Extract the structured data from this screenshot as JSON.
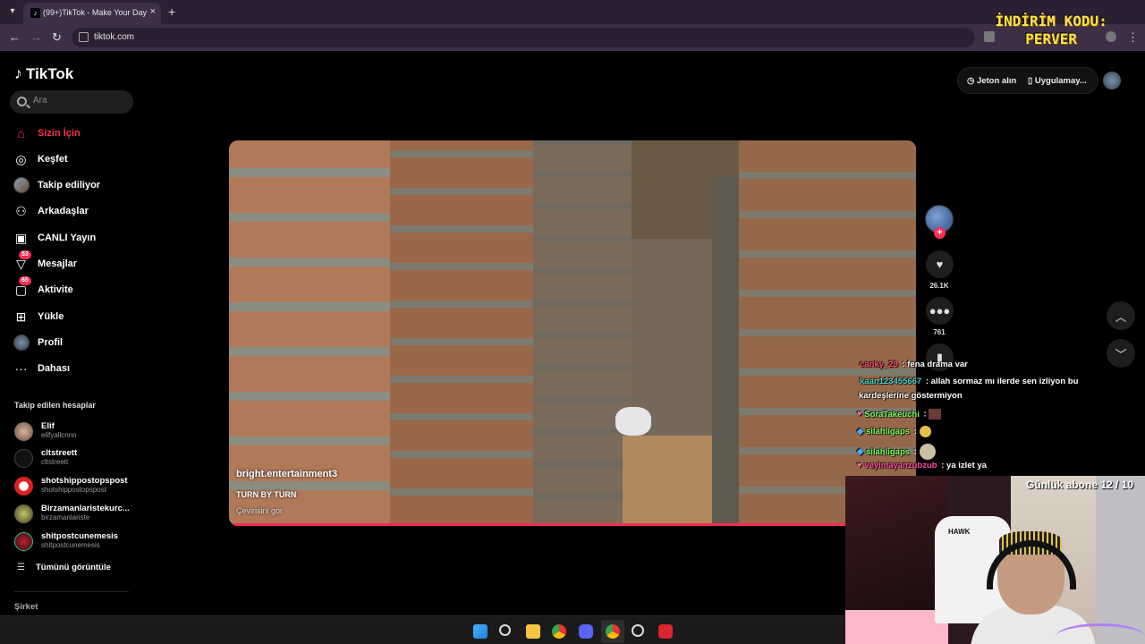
{
  "browser": {
    "tab_title": "(99+)TikTok - Make Your Day",
    "tab_close": "×",
    "new_tab": "+",
    "url": "tiktok.com",
    "promo_line1": "İNDİRİM KODU:",
    "promo_line2": "PERVER"
  },
  "sidebar": {
    "logo": "TikTok",
    "search_placeholder": "Ara",
    "items": [
      {
        "label": "Sizin İçin",
        "icon": "home-icon",
        "active": true
      },
      {
        "label": "Keşfet",
        "icon": "compass-icon"
      },
      {
        "label": "Takip ediliyor",
        "icon": "following-avatar"
      },
      {
        "label": "Arkadaşlar",
        "icon": "friends-icon"
      },
      {
        "label": "CANLI Yayın",
        "icon": "live-icon"
      },
      {
        "label": "Mesajlar",
        "icon": "messages-icon",
        "badge": "53"
      },
      {
        "label": "Aktivite",
        "icon": "activity-icon",
        "badge": "65"
      },
      {
        "label": "Yükle",
        "icon": "upload-icon"
      },
      {
        "label": "Profil",
        "icon": "profile-avatar"
      },
      {
        "label": "Dahası",
        "icon": "more-icon"
      }
    ],
    "following_header": "Takip edilen hesaplar",
    "following": [
      {
        "name": "Elif",
        "user": "elifyallcnnn"
      },
      {
        "name": "cltstreett",
        "user": "cltstreett"
      },
      {
        "name": "shotshippostopspost",
        "user": "shotshippostopspost"
      },
      {
        "name": "Birzamanlaristekurc...",
        "user": "birzamanlariste"
      },
      {
        "name": "shitpostcunemesis",
        "user": "shitpostcunemesis"
      }
    ],
    "see_all": "Tümünü görüntüle",
    "company": "Şirket"
  },
  "topbar": {
    "coins": "Jeton alın",
    "app": "Uygulamay..."
  },
  "video": {
    "author": "bright.entertainment3",
    "title": "TURN BY TURN",
    "translate": "Çevirisini gör",
    "progress": 0.9
  },
  "actions": {
    "likes": "26.1K",
    "comments": "761",
    "follow_plus": "+"
  },
  "chat": [
    {
      "user": "canky_29",
      "sep": " : ",
      "text": "fena drama var",
      "color": "#ff4d6d"
    },
    {
      "user": "kaan123455667",
      "sep": " : ",
      "text": "allah sormaz mı ilerde sen izliyon bu",
      "color": "#4fd1c5"
    },
    {
      "user": "",
      "sep": "",
      "text": "kardeşlerine göstermiyon",
      "color": "#fff"
    },
    {
      "user": "SoraTakeuchi",
      "sep": " : ",
      "text": "",
      "color": "#7bff5c"
    },
    {
      "user": "silahligaps",
      "sep": " : ",
      "text": "",
      "color": "#7bff5c"
    },
    {
      "user": "silahligaps",
      "sep": " : ",
      "text": "",
      "color": "#7bff5c"
    },
    {
      "user": "veyimayanzubzub",
      "sep": " : ",
      "text": "ya izlet ya",
      "color": "#ff4d9e"
    }
  ],
  "stream": {
    "sub_goal": "Günlük abone 12 / 10",
    "chair_brand": "HAWK"
  },
  "colors": {
    "accent": "#fe2c55",
    "browser_bg": "#2b1f33",
    "promo": "#ffe14a"
  }
}
